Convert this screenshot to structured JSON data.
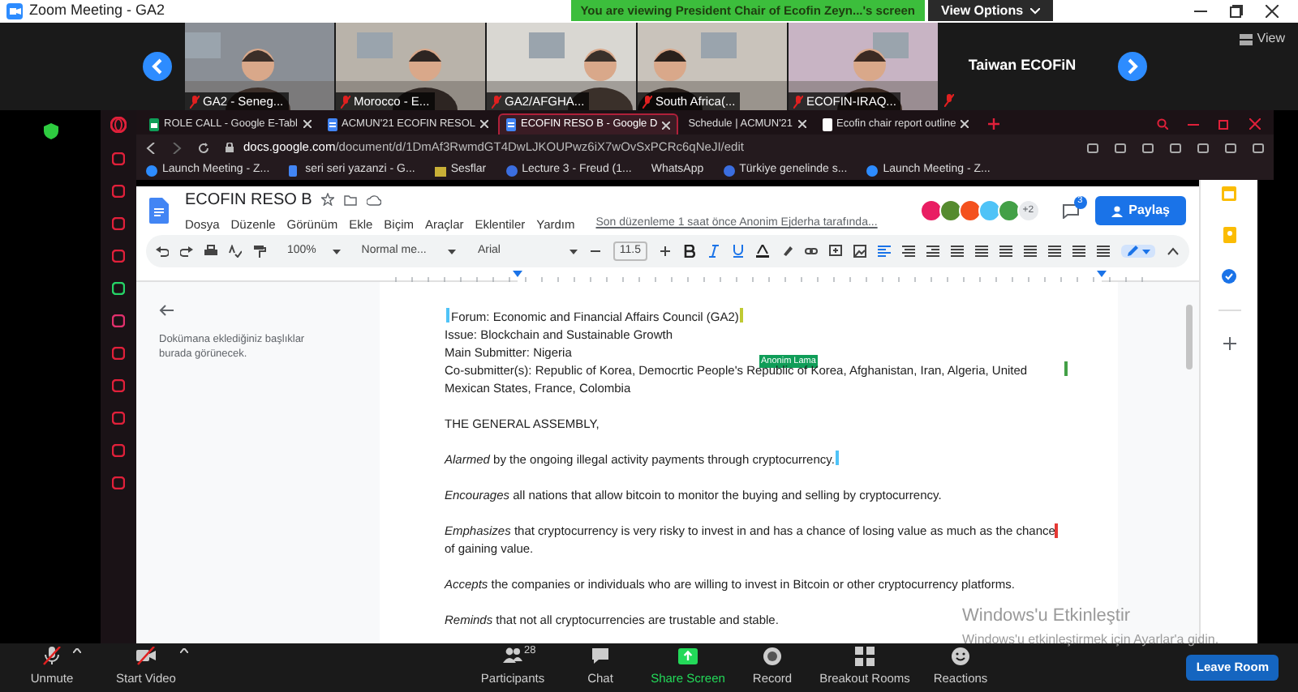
{
  "window": {
    "title": "Zoom Meeting - GA2"
  },
  "share_banner": {
    "text": "You are viewing President Chair of Ecofin Zeyn...'s screen",
    "options": "View Options"
  },
  "gallery": {
    "tiles": [
      {
        "kind": "video",
        "name": "GA2 - Seneg..."
      },
      {
        "kind": "video",
        "name": "Morocco - E..."
      },
      {
        "kind": "video",
        "name": "GA2/AFGHA..."
      },
      {
        "kind": "video",
        "name": "South Africa(..."
      },
      {
        "kind": "video",
        "name": "ECOFIN-IRAQ..."
      },
      {
        "kind": "name_only",
        "name": "Taiwan ECOFiN"
      }
    ],
    "view": "View"
  },
  "browser": {
    "tabs": [
      {
        "kind": "sheets",
        "title": "ROLE CALL - Google E-Tabl",
        "selected": false
      },
      {
        "kind": "docs",
        "title": "ACMUN'21 ECOFIN RESOL",
        "selected": false
      },
      {
        "kind": "docs",
        "title": "ECOFIN RESO B - Google D",
        "selected": true
      },
      {
        "kind": "plain",
        "title": "Schedule | ACMUN'21",
        "selected": false
      },
      {
        "kind": "page",
        "title": "Ecofin chair report outline",
        "selected": false
      }
    ],
    "url_host": "docs.google.com",
    "url_path": "/document/d/1DmAf3RwmdGT4DwLJKOUPwz6iX7wOvSxPCRc6qNeJI/edit",
    "bookmarks": [
      {
        "kind": "zoom",
        "title": "Launch Meeting - Z..."
      },
      {
        "kind": "docs",
        "title": "seri seri yazanzi - G..."
      },
      {
        "kind": "folder",
        "title": "Sesflar"
      },
      {
        "kind": "circle",
        "title": "Lecture 3 - Freud (1..."
      },
      {
        "kind": "plain",
        "title": "WhatsApp"
      },
      {
        "kind": "circle",
        "title": "Türkiye genelinde s..."
      },
      {
        "kind": "zoom",
        "title": "Launch Meeting - Z..."
      }
    ]
  },
  "doc": {
    "title": "ECOFIN RESO B",
    "menus": [
      "Dosya",
      "Düzenle",
      "Görünüm",
      "Ekle",
      "Biçim",
      "Araçlar",
      "Eklentiler",
      "Yardım"
    ],
    "last_edit": "Son düzenleme 1 saat önce Anonim Ejderha tarafında...",
    "collaborators": [
      {
        "color": "#e91e63"
      },
      {
        "color": "#558b2f"
      },
      {
        "color": "#f4511e"
      },
      {
        "color": "#4fc3f7"
      },
      {
        "color": "#43a047"
      }
    ],
    "more_collaborators": "+2",
    "comments_badge": "3",
    "share": "Paylaş",
    "toolbar": {
      "zoom": "100%",
      "style": "Normal me...",
      "font": "Arial",
      "size": "11.5"
    },
    "outline_hint": "Dokümana eklediğiniz başlıklar burada görünecek.",
    "paragraphs": [
      {
        "lines": [
          {
            "text": "Forum: Economic and Financial Affairs Council (GA2)",
            "cursors": [
              {
                "kind": "start",
                "color": "#4fc3f7"
              },
              {
                "kind": "end",
                "color": "#c0ca33"
              }
            ]
          },
          {
            "text": "Issue: Blockchain and Sustainable Growth"
          },
          {
            "text": "Main Submitter: Nigeria"
          },
          {
            "text": "Co-submitter(s): Republic of Korea, Democrtic People's Republic of Korea, Afghanistan, Iran, Algeria, United Mexican States, France, Colombia",
            "cursors": [
              {
                "kind": "end",
                "color": "#43a047"
              }
            ]
          }
        ]
      },
      {
        "lines": [
          {
            "text": "THE GENERAL ASSEMBLY,"
          }
        ]
      },
      {
        "lines": [
          {
            "text": "*Alarmed* by the ongoing illegal activity payments through cryptocurrency.",
            "cursors": [
              {
                "kind": "end",
                "color": "#4fc3f7"
              }
            ]
          }
        ]
      },
      {
        "lines": [
          {
            "text": "*Encourages* all nations that allow bitcoin to monitor the buying and selling by cryptocurrency."
          }
        ]
      },
      {
        "lines": [
          {
            "text": "*Emphasizes* that cryptocurrency is very risky to invest in and has a chance of losing value as much as the chance of gaining value.",
            "cursors": [
              {
                "kind": "mid",
                "color": "#e53935"
              }
            ]
          }
        ]
      },
      {
        "lines": [
          {
            "text": "*Accepts* the companies or individuals who are willing to invest in Bitcoin or other cryptocurrency platforms."
          }
        ]
      },
      {
        "lines": [
          {
            "text": "*Reminds* that not all cryptocurrencies are trustable and stable."
          }
        ]
      }
    ],
    "cursor_label": {
      "text": "Anonim Lama",
      "color": "#0f9d58"
    }
  },
  "activation": {
    "title": "Windows'u Etkinleştir",
    "subtitle": "Windows'u etkinleştirmek için Ayarlar'a gidin."
  },
  "controls": [
    {
      "kind": "mic_off",
      "label": "Unmute"
    },
    {
      "kind": "video_off",
      "label": "Start Video"
    },
    {
      "kind": "participants",
      "label": "Participants",
      "count": "28"
    },
    {
      "kind": "chat",
      "label": "Chat"
    },
    {
      "kind": "share",
      "label": "Share Screen"
    },
    {
      "kind": "record",
      "label": "Record"
    },
    {
      "kind": "rooms",
      "label": "Breakout Rooms"
    },
    {
      "kind": "reactions",
      "label": "Reactions"
    }
  ],
  "leave": "Leave Room"
}
